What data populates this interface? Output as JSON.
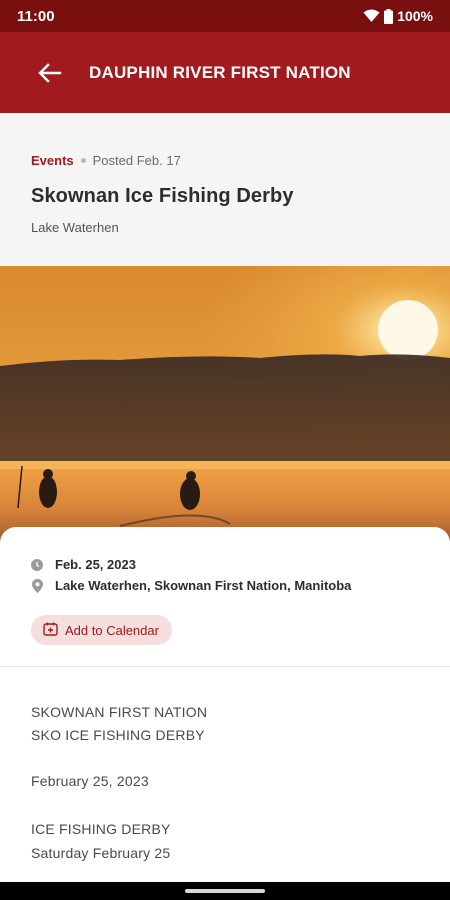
{
  "status": {
    "time": "11:00",
    "battery": "100%"
  },
  "app_bar": {
    "title": "DAUPHIN RIVER FIRST NATION"
  },
  "post": {
    "category": "Events",
    "posted": "Posted Feb. 17",
    "title": "Skownan Ice Fishing Derby",
    "subtitle": "Lake Waterhen"
  },
  "details": {
    "date": "Feb. 25, 2023",
    "location": "Lake Waterhen, Skownan First Nation, Manitoba",
    "add_to_calendar": "Add to Calendar"
  },
  "description": {
    "line1": "SKOWNAN FIRST NATION",
    "line2": "SKO ICE FISHING DERBY",
    "line3": "February 25, 2023",
    "line4": "ICE FISHING DERBY",
    "line5": "Saturday February 25"
  },
  "colors": {
    "brand": "#a01a1e",
    "status_bar": "#7a0f10",
    "accent_bg": "#f5dede"
  }
}
